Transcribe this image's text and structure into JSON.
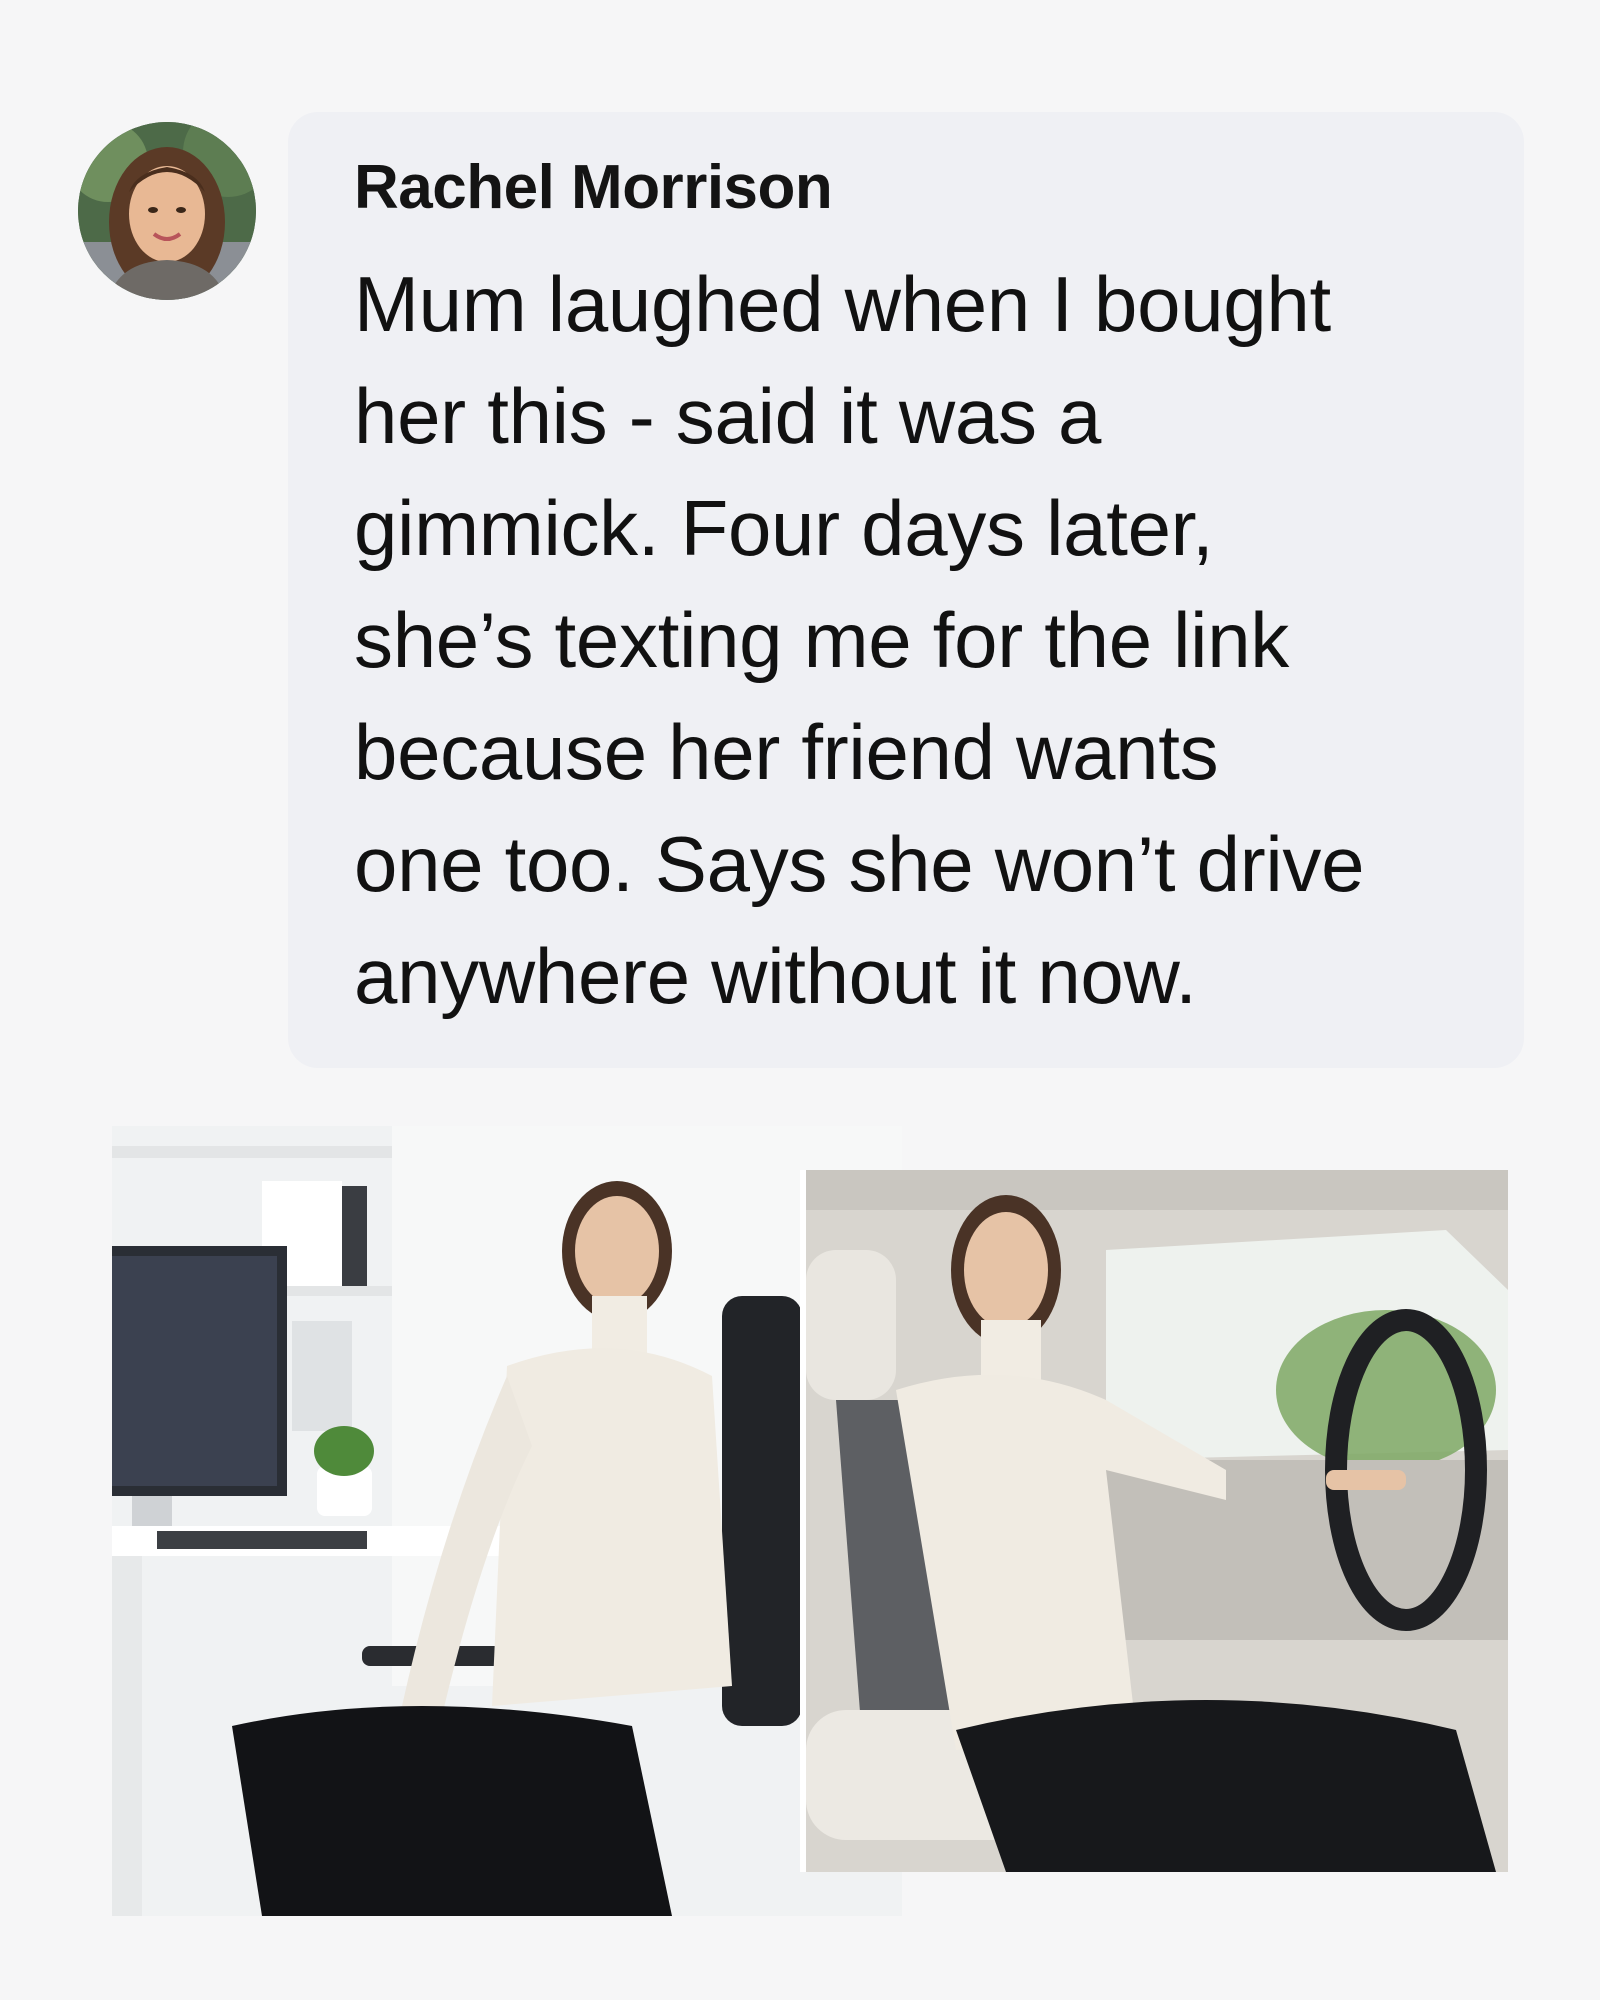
{
  "comment": {
    "author": "Rachel Morrison",
    "lines": [
      "Mum laughed when I bought",
      "her this - said it was a",
      "gimmick. Four days later,",
      "she’s texting me for the link",
      "because her friend wants",
      "one too. Says she won’t drive",
      "anywhere without it now."
    ]
  },
  "avatar_icon": "profile-photo",
  "photos": [
    {
      "icon": "woman-office-chair-photo"
    },
    {
      "icon": "woman-car-seat-photo"
    }
  ],
  "colors": {
    "bubble": "#eff0f4",
    "text": "#111111",
    "background": "#f6f6f7"
  }
}
